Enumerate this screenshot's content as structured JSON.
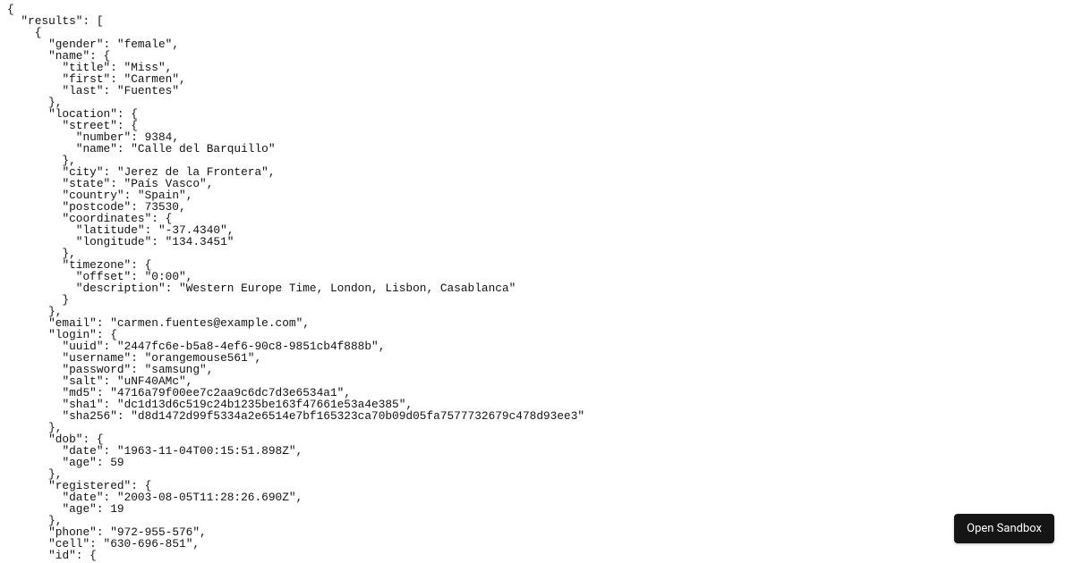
{
  "button": {
    "open_sandbox_label": "Open Sandbox"
  },
  "api_response": {
    "results": [
      {
        "gender": "female",
        "name": {
          "title": "Miss",
          "first": "Carmen",
          "last": "Fuentes"
        },
        "location": {
          "street": {
            "number": 9384,
            "name": "Calle del Barquillo"
          },
          "city": "Jerez de la Frontera",
          "state": "País Vasco",
          "country": "Spain",
          "postcode": 73530,
          "coordinates": {
            "latitude": "-37.4340",
            "longitude": "134.3451"
          },
          "timezone": {
            "offset": "0:00",
            "description": "Western Europe Time, London, Lisbon, Casablanca"
          }
        },
        "email": "carmen.fuentes@example.com",
        "login": {
          "uuid": "2447fc6e-b5a8-4ef6-90c8-9851cb4f888b",
          "username": "orangemouse561",
          "password": "samsung",
          "salt": "uNF40AMc",
          "md5": "4716a79f00ee7c2aa9c6dc7d3e6534a1",
          "sha1": "dc1d13d6c519c24b1235be163f47661e53a4e385",
          "sha256": "d8d1472d99f5334a2e6514e7bf165323ca70b09d05fa7577732679c478d93ee3"
        },
        "dob": {
          "date": "1963-11-04T00:15:51.898Z",
          "age": 59
        },
        "registered": {
          "date": "2003-08-05T11:28:26.690Z",
          "age": 19
        },
        "phone": "972-955-576",
        "cell": "630-696-851",
        "id_partial_key": "id"
      }
    ]
  }
}
